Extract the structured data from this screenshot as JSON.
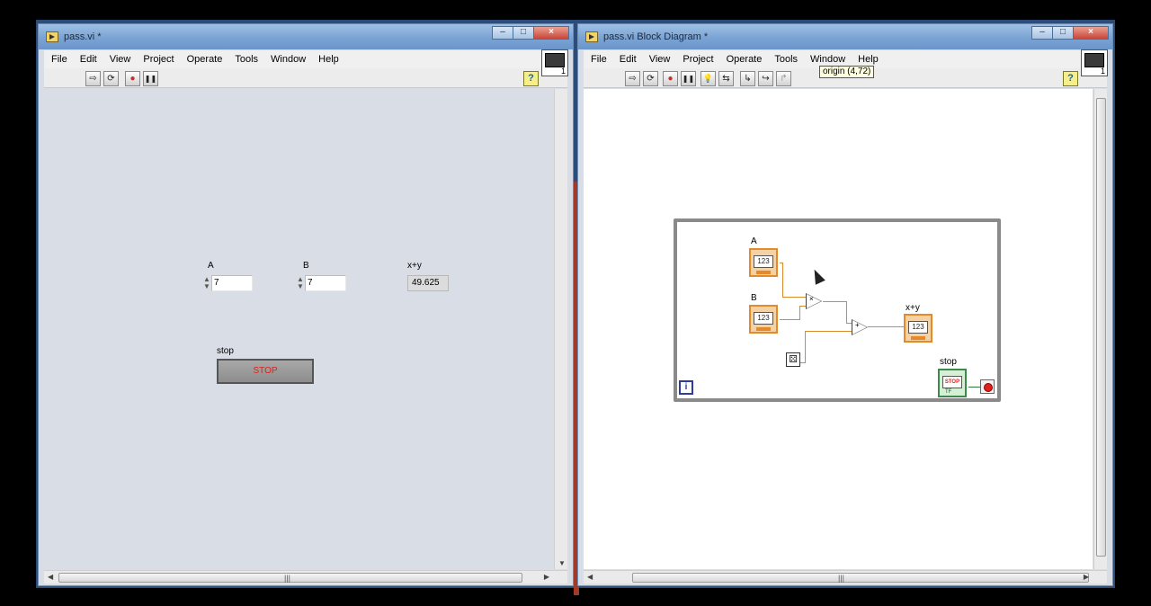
{
  "front_panel": {
    "title": "pass.vi *",
    "menu": [
      "File",
      "Edit",
      "View",
      "Project",
      "Operate",
      "Tools",
      "Window",
      "Help"
    ],
    "controls": {
      "a_label": "A",
      "a_value": "7",
      "b_label": "B",
      "b_value": "7",
      "sum_label": "x+y",
      "sum_value": "49.625",
      "stop_label": "stop",
      "stop_button_text": "STOP"
    }
  },
  "block_diagram": {
    "title": "pass.vi Block Diagram *",
    "menu": [
      "File",
      "Edit",
      "View",
      "Project",
      "Operate",
      "Tools",
      "Window",
      "Help"
    ],
    "tooltip": "origin (4,72)",
    "terminals": {
      "a_label": "A",
      "b_label": "B",
      "sum_label": "x+y",
      "stop_label": "stop",
      "numeric_text": "123",
      "stop_text": "STOP",
      "tf_text": "TF",
      "iteration_text": "i"
    },
    "primitives": {
      "multiply_symbol": "×",
      "add_symbol": "+"
    }
  },
  "window_buttons": {
    "minimize": "–",
    "maximize": "□",
    "close": "×"
  },
  "icons": {
    "run": "⇨",
    "run_continuous": "⟳",
    "abort": "●",
    "pause": "❚❚",
    "highlight": "💡",
    "retain": "⇆",
    "step_into": "↳",
    "step_over": "↪",
    "step_out": "↱",
    "help": "?",
    "dice": "⚄",
    "grip": "|||"
  }
}
